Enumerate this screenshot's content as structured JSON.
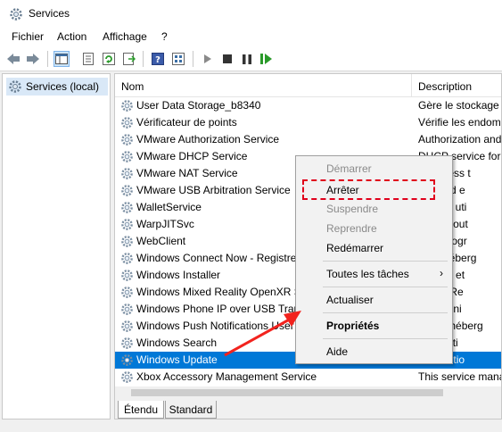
{
  "window": {
    "title": "Services"
  },
  "menubar": {
    "items": [
      "Fichier",
      "Action",
      "Affichage",
      "?"
    ]
  },
  "tree": {
    "root_label": "Services (local)"
  },
  "list": {
    "columns": {
      "name": "Nom",
      "description": "Description"
    },
    "rows": [
      {
        "name": "User Data Storage_b8340",
        "desc": "Gère le stockage d"
      },
      {
        "name": "Vérificateur de points",
        "desc": "Vérifie les endomm"
      },
      {
        "name": "VMware Authorization Service",
        "desc": "Authorization and"
      },
      {
        "name": "VMware DHCP Service",
        "desc": "DHCP service for v"
      },
      {
        "name": "VMware NAT Service",
        "desc": "k address t"
      },
      {
        "name": "VMware USB Arbitration Service",
        "desc": "tion and e"
      },
      {
        "name": "WalletService",
        "desc": "d'hôtes uti"
      },
      {
        "name": "WarpJITSvc",
        "desc": "s a JIT out"
      },
      {
        "name": "WebClient",
        "desc": "à un progr"
      },
      {
        "name": "Windows Connect Now - Registre",
        "desc": "SVC héberg"
      },
      {
        "name": "Windows Installer",
        "desc": "modifie et"
      },
      {
        "name": "Windows Mixed Reality OpenXR S",
        "desc": "Mixed Re"
      },
      {
        "name": "Windows Phone IP over USB Trans",
        "desc": "communi"
      },
      {
        "name": "Windows Push Notifications User",
        "desc": "ervice héberg"
      },
      {
        "name": "Windows Search",
        "desc": "es foncti"
      },
      {
        "name": "Windows Update",
        "desc": "a détectio",
        "selected": true
      },
      {
        "name": "Xbox Accessory Management Service",
        "desc": "This service mana"
      }
    ]
  },
  "tabs": {
    "etendu": "Étendu",
    "standard": "Standard"
  },
  "context_menu": {
    "demarrer": "Démarrer",
    "arreter": "Arrêter",
    "suspendre": "Suspendre",
    "reprendre": "Reprendre",
    "redemarrer": "Redémarrer",
    "toutes_taches": "Toutes les tâches",
    "actualiser": "Actualiser",
    "proprietes": "Propriétés",
    "aide": "Aide"
  },
  "colors": {
    "selection": "#0078d7",
    "highlight": "#e0001b"
  }
}
